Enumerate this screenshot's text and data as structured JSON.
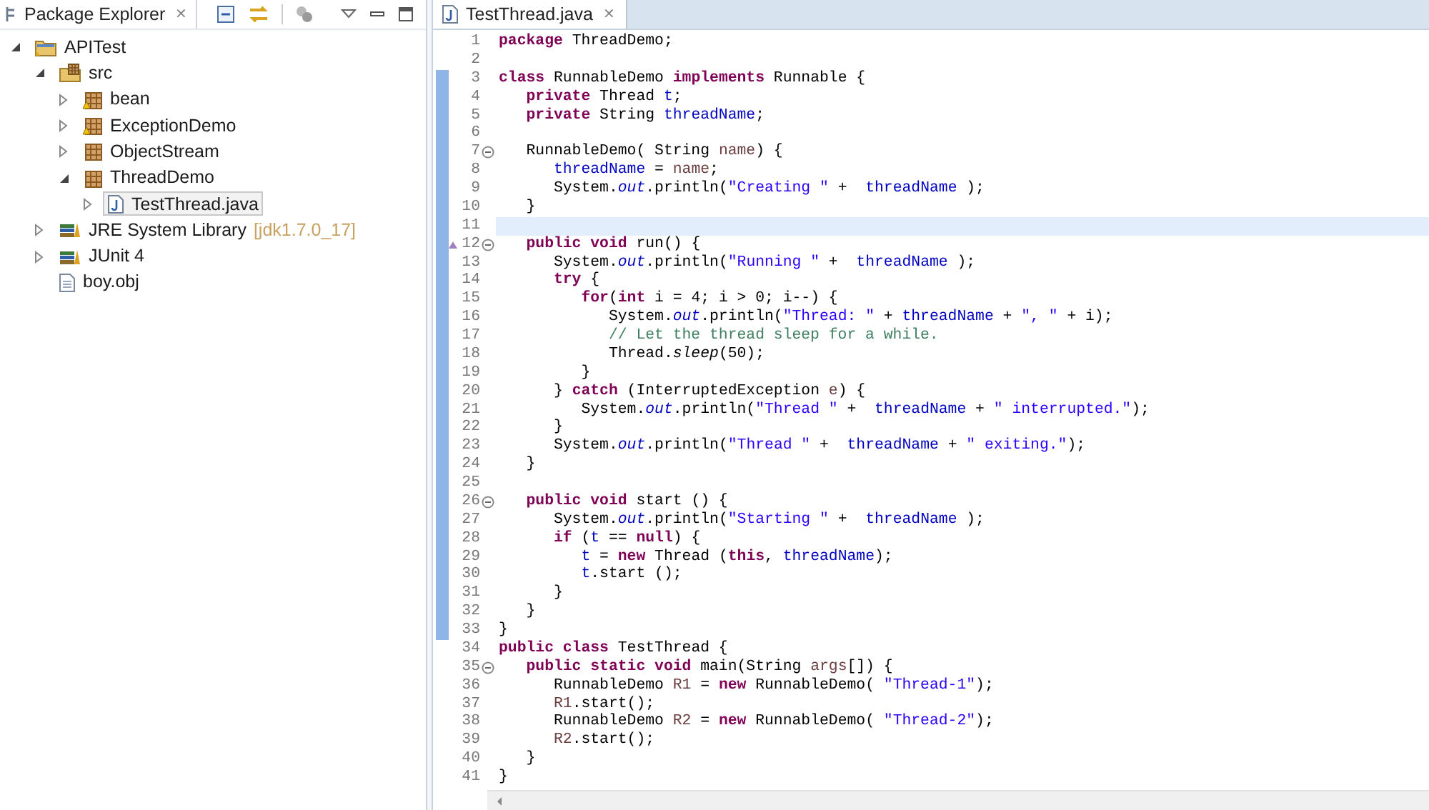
{
  "explorer": {
    "title": "Package Explorer",
    "close": "✕",
    "tree": [
      {
        "label": "APITest",
        "kind": "project",
        "expanded": true,
        "selected": false,
        "children": [
          {
            "label": "src",
            "kind": "source-folder",
            "expanded": true,
            "selected": false,
            "children": [
              {
                "label": "bean",
                "kind": "package-warning",
                "expanded": false,
                "selected": false
              },
              {
                "label": "ExceptionDemo",
                "kind": "package-warning",
                "expanded": false,
                "selected": false
              },
              {
                "label": "ObjectStream",
                "kind": "package",
                "expanded": false,
                "selected": false
              },
              {
                "label": "ThreadDemo",
                "kind": "package",
                "expanded": true,
                "selected": false,
                "children": [
                  {
                    "label": "TestThread.java",
                    "kind": "java-file",
                    "expanded": false,
                    "selected": true
                  }
                ]
              }
            ]
          },
          {
            "label": "JRE System Library",
            "decoration": "[jdk1.7.0_17]",
            "kind": "library",
            "expanded": false,
            "selected": false
          },
          {
            "label": "JUnit 4",
            "kind": "library",
            "expanded": false,
            "selected": false
          },
          {
            "label": "boy.obj",
            "kind": "file",
            "selected": false
          }
        ]
      }
    ]
  },
  "editor": {
    "tab": {
      "title": "TestThread.java",
      "close": "✕"
    },
    "lines": [
      {
        "number": "1",
        "changed": false,
        "current": false,
        "fold": false,
        "override": false,
        "tokens": [
          {
            "kind": "keyword",
            "text": "package"
          },
          {
            "kind": "plain",
            "text": " ThreadDemo;"
          }
        ]
      },
      {
        "number": "2",
        "changed": false,
        "current": false,
        "fold": false,
        "override": false
      },
      {
        "number": "3",
        "changed": true,
        "current": false,
        "fold": false,
        "override": false,
        "tokens": [
          {
            "kind": "keyword",
            "text": "class"
          },
          {
            "kind": "plain",
            "text": " RunnableDemo "
          },
          {
            "kind": "keyword",
            "text": "implements"
          },
          {
            "kind": "plain",
            "text": " Runnable {"
          }
        ]
      },
      {
        "number": "4",
        "changed": true,
        "current": false,
        "fold": false,
        "override": false,
        "tokens": [
          {
            "kind": "keyword",
            "text": "   private"
          },
          {
            "kind": "plain",
            "text": " Thread "
          },
          {
            "kind": "field",
            "text": "t"
          },
          {
            "kind": "plain",
            "text": ";"
          }
        ]
      },
      {
        "number": "5",
        "changed": true,
        "current": false,
        "fold": false,
        "override": false,
        "tokens": [
          {
            "kind": "keyword",
            "text": "   private"
          },
          {
            "kind": "plain",
            "text": " String "
          },
          {
            "kind": "field",
            "text": "threadName"
          },
          {
            "kind": "plain",
            "text": ";"
          }
        ]
      },
      {
        "number": "6",
        "changed": true,
        "current": false,
        "fold": false,
        "override": false
      },
      {
        "number": "7",
        "changed": true,
        "current": false,
        "fold": true,
        "override": false,
        "tokens": [
          {
            "kind": "plain",
            "text": "   RunnableDemo( String "
          },
          {
            "kind": "variable",
            "text": "name"
          },
          {
            "kind": "plain",
            "text": ") {"
          }
        ]
      },
      {
        "number": "8",
        "changed": true,
        "current": false,
        "fold": false,
        "override": false,
        "tokens": [
          {
            "kind": "field",
            "text": "      threadName"
          },
          {
            "kind": "plain",
            "text": " = "
          },
          {
            "kind": "variable",
            "text": "name"
          },
          {
            "kind": "plain",
            "text": ";"
          }
        ]
      },
      {
        "number": "9",
        "changed": true,
        "current": false,
        "fold": false,
        "override": false,
        "tokens": [
          {
            "kind": "plain",
            "text": "      System."
          },
          {
            "kind": "static",
            "text": "out"
          },
          {
            "kind": "plain",
            "text": ".println("
          },
          {
            "kind": "string",
            "text": "\"Creating \""
          },
          {
            "kind": "plain",
            "text": " +  "
          },
          {
            "kind": "field",
            "text": "threadName"
          },
          {
            "kind": "plain",
            "text": " );"
          }
        ]
      },
      {
        "number": "10",
        "changed": true,
        "current": false,
        "fold": false,
        "override": false,
        "tokens": [
          {
            "kind": "plain",
            "text": "   }"
          }
        ]
      },
      {
        "number": "11",
        "changed": true,
        "current": true,
        "fold": false,
        "override": false
      },
      {
        "number": "12",
        "changed": true,
        "current": false,
        "fold": true,
        "override": true,
        "tokens": [
          {
            "kind": "keyword",
            "text": "   public void"
          },
          {
            "kind": "plain",
            "text": " run() {"
          }
        ]
      },
      {
        "number": "13",
        "changed": true,
        "current": false,
        "fold": false,
        "override": false,
        "tokens": [
          {
            "kind": "plain",
            "text": "      System."
          },
          {
            "kind": "static",
            "text": "out"
          },
          {
            "kind": "plain",
            "text": ".println("
          },
          {
            "kind": "string",
            "text": "\"Running \""
          },
          {
            "kind": "plain",
            "text": " +  "
          },
          {
            "kind": "field",
            "text": "threadName"
          },
          {
            "kind": "plain",
            "text": " );"
          }
        ]
      },
      {
        "number": "14",
        "changed": true,
        "current": false,
        "fold": false,
        "override": false,
        "tokens": [
          {
            "kind": "keyword",
            "text": "      try"
          },
          {
            "kind": "plain",
            "text": " {"
          }
        ]
      },
      {
        "number": "15",
        "changed": true,
        "current": false,
        "fold": false,
        "override": false,
        "tokens": [
          {
            "kind": "keyword",
            "text": "         for"
          },
          {
            "kind": "plain",
            "text": "("
          },
          {
            "kind": "keyword",
            "text": "int"
          },
          {
            "kind": "plain",
            "text": " i = 4; i > 0; i--) {"
          }
        ]
      },
      {
        "number": "16",
        "changed": true,
        "current": false,
        "fold": false,
        "override": false,
        "tokens": [
          {
            "kind": "plain",
            "text": "            System."
          },
          {
            "kind": "static",
            "text": "out"
          },
          {
            "kind": "plain",
            "text": ".println("
          },
          {
            "kind": "string",
            "text": "\"Thread: \""
          },
          {
            "kind": "plain",
            "text": " + "
          },
          {
            "kind": "field",
            "text": "threadName"
          },
          {
            "kind": "plain",
            "text": " + "
          },
          {
            "kind": "string",
            "text": "\", \""
          },
          {
            "kind": "plain",
            "text": " + i);"
          }
        ]
      },
      {
        "number": "17",
        "changed": true,
        "current": false,
        "fold": false,
        "override": false,
        "tokens": [
          {
            "kind": "comment",
            "text": "            // Let the thread sleep for a while."
          }
        ]
      },
      {
        "number": "18",
        "changed": true,
        "current": false,
        "fold": false,
        "override": false,
        "tokens": [
          {
            "kind": "plain",
            "text": "            Thread."
          },
          {
            "kind": "static-method",
            "text": "sleep"
          },
          {
            "kind": "plain",
            "text": "(50);"
          }
        ]
      },
      {
        "number": "19",
        "changed": true,
        "current": false,
        "fold": false,
        "override": false,
        "tokens": [
          {
            "kind": "plain",
            "text": "         }"
          }
        ]
      },
      {
        "number": "20",
        "changed": true,
        "current": false,
        "fold": false,
        "override": false,
        "tokens": [
          {
            "kind": "plain",
            "text": "      } "
          },
          {
            "kind": "keyword",
            "text": "catch"
          },
          {
            "kind": "plain",
            "text": " (InterruptedException "
          },
          {
            "kind": "variable",
            "text": "e"
          },
          {
            "kind": "plain",
            "text": ") {"
          }
        ]
      },
      {
        "number": "21",
        "changed": true,
        "current": false,
        "fold": false,
        "override": false,
        "tokens": [
          {
            "kind": "plain",
            "text": "         System."
          },
          {
            "kind": "static",
            "text": "out"
          },
          {
            "kind": "plain",
            "text": ".println("
          },
          {
            "kind": "string",
            "text": "\"Thread \""
          },
          {
            "kind": "plain",
            "text": " +  "
          },
          {
            "kind": "field",
            "text": "threadName"
          },
          {
            "kind": "plain",
            "text": " + "
          },
          {
            "kind": "string",
            "text": "\" interrupted.\""
          },
          {
            "kind": "plain",
            "text": ");"
          }
        ]
      },
      {
        "number": "22",
        "changed": true,
        "current": false,
        "fold": false,
        "override": false,
        "tokens": [
          {
            "kind": "plain",
            "text": "      }"
          }
        ]
      },
      {
        "number": "23",
        "changed": true,
        "current": false,
        "fold": false,
        "override": false,
        "tokens": [
          {
            "kind": "plain",
            "text": "      System."
          },
          {
            "kind": "static",
            "text": "out"
          },
          {
            "kind": "plain",
            "text": ".println("
          },
          {
            "kind": "string",
            "text": "\"Thread \""
          },
          {
            "kind": "plain",
            "text": " +  "
          },
          {
            "kind": "field",
            "text": "threadName"
          },
          {
            "kind": "plain",
            "text": " + "
          },
          {
            "kind": "string",
            "text": "\" exiting.\""
          },
          {
            "kind": "plain",
            "text": ");"
          }
        ]
      },
      {
        "number": "24",
        "changed": true,
        "current": false,
        "fold": false,
        "override": false,
        "tokens": [
          {
            "kind": "plain",
            "text": "   }"
          }
        ]
      },
      {
        "number": "25",
        "changed": true,
        "current": false,
        "fold": false,
        "override": false
      },
      {
        "number": "26",
        "changed": true,
        "current": false,
        "fold": true,
        "override": false,
        "tokens": [
          {
            "kind": "keyword",
            "text": "   public void"
          },
          {
            "kind": "plain",
            "text": " start () {"
          }
        ]
      },
      {
        "number": "27",
        "changed": true,
        "current": false,
        "fold": false,
        "override": false,
        "tokens": [
          {
            "kind": "plain",
            "text": "      System."
          },
          {
            "kind": "static",
            "text": "out"
          },
          {
            "kind": "plain",
            "text": ".println("
          },
          {
            "kind": "string",
            "text": "\"Starting \""
          },
          {
            "kind": "plain",
            "text": " +  "
          },
          {
            "kind": "field",
            "text": "threadName"
          },
          {
            "kind": "plain",
            "text": " );"
          }
        ]
      },
      {
        "number": "28",
        "changed": true,
        "current": false,
        "fold": false,
        "override": false,
        "tokens": [
          {
            "kind": "keyword",
            "text": "      if"
          },
          {
            "kind": "plain",
            "text": " ("
          },
          {
            "kind": "field",
            "text": "t"
          },
          {
            "kind": "plain",
            "text": " == "
          },
          {
            "kind": "keyword",
            "text": "null"
          },
          {
            "kind": "plain",
            "text": ") {"
          }
        ]
      },
      {
        "number": "29",
        "changed": true,
        "current": false,
        "fold": false,
        "override": false,
        "tokens": [
          {
            "kind": "field",
            "text": "         t"
          },
          {
            "kind": "plain",
            "text": " = "
          },
          {
            "kind": "keyword",
            "text": "new"
          },
          {
            "kind": "plain",
            "text": " Thread ("
          },
          {
            "kind": "keyword",
            "text": "this"
          },
          {
            "kind": "plain",
            "text": ", "
          },
          {
            "kind": "field",
            "text": "threadName"
          },
          {
            "kind": "plain",
            "text": ");"
          }
        ]
      },
      {
        "number": "30",
        "changed": true,
        "current": false,
        "fold": false,
        "override": false,
        "tokens": [
          {
            "kind": "field",
            "text": "         t"
          },
          {
            "kind": "plain",
            "text": ".start ();"
          }
        ]
      },
      {
        "number": "31",
        "changed": true,
        "current": false,
        "fold": false,
        "override": false,
        "tokens": [
          {
            "kind": "plain",
            "text": "      }"
          }
        ]
      },
      {
        "number": "32",
        "changed": true,
        "current": false,
        "fold": false,
        "override": false,
        "tokens": [
          {
            "kind": "plain",
            "text": "   }"
          }
        ]
      },
      {
        "number": "33",
        "changed": true,
        "current": false,
        "fold": false,
        "override": false,
        "tokens": [
          {
            "kind": "plain",
            "text": "}"
          }
        ]
      },
      {
        "number": "34",
        "changed": false,
        "current": false,
        "fold": false,
        "override": false,
        "tokens": [
          {
            "kind": "keyword",
            "text": "public class"
          },
          {
            "kind": "plain",
            "text": " TestThread {"
          }
        ]
      },
      {
        "number": "35",
        "changed": false,
        "current": false,
        "fold": true,
        "override": false,
        "tokens": [
          {
            "kind": "keyword",
            "text": "   public static void"
          },
          {
            "kind": "plain",
            "text": " main(String "
          },
          {
            "kind": "variable",
            "text": "args"
          },
          {
            "kind": "plain",
            "text": "[]) {"
          }
        ]
      },
      {
        "number": "36",
        "changed": false,
        "current": false,
        "fold": false,
        "override": false,
        "tokens": [
          {
            "kind": "plain",
            "text": "      RunnableDemo "
          },
          {
            "kind": "variable",
            "text": "R1"
          },
          {
            "kind": "plain",
            "text": " = "
          },
          {
            "kind": "keyword",
            "text": "new"
          },
          {
            "kind": "plain",
            "text": " RunnableDemo( "
          },
          {
            "kind": "string",
            "text": "\"Thread-1\""
          },
          {
            "kind": "plain",
            "text": ");"
          }
        ]
      },
      {
        "number": "37",
        "changed": false,
        "current": false,
        "fold": false,
        "override": false,
        "tokens": [
          {
            "kind": "variable",
            "text": "      R1"
          },
          {
            "kind": "plain",
            "text": ".start();"
          }
        ]
      },
      {
        "number": "38",
        "changed": false,
        "current": false,
        "fold": false,
        "override": false,
        "tokens": [
          {
            "kind": "plain",
            "text": "      RunnableDemo "
          },
          {
            "kind": "variable",
            "text": "R2"
          },
          {
            "kind": "plain",
            "text": " = "
          },
          {
            "kind": "keyword",
            "text": "new"
          },
          {
            "kind": "plain",
            "text": " RunnableDemo( "
          },
          {
            "kind": "string",
            "text": "\"Thread-2\""
          },
          {
            "kind": "plain",
            "text": ");"
          }
        ]
      },
      {
        "number": "39",
        "changed": false,
        "current": false,
        "fold": false,
        "override": false,
        "tokens": [
          {
            "kind": "variable",
            "text": "      R2"
          },
          {
            "kind": "plain",
            "text": ".start();"
          }
        ]
      },
      {
        "number": "40",
        "changed": false,
        "current": false,
        "fold": false,
        "override": false,
        "tokens": [
          {
            "kind": "plain",
            "text": "   }"
          }
        ]
      },
      {
        "number": "41",
        "changed": false,
        "current": false,
        "fold": false,
        "override": false,
        "tokens": [
          {
            "kind": "plain",
            "text": "}"
          }
        ]
      }
    ]
  }
}
